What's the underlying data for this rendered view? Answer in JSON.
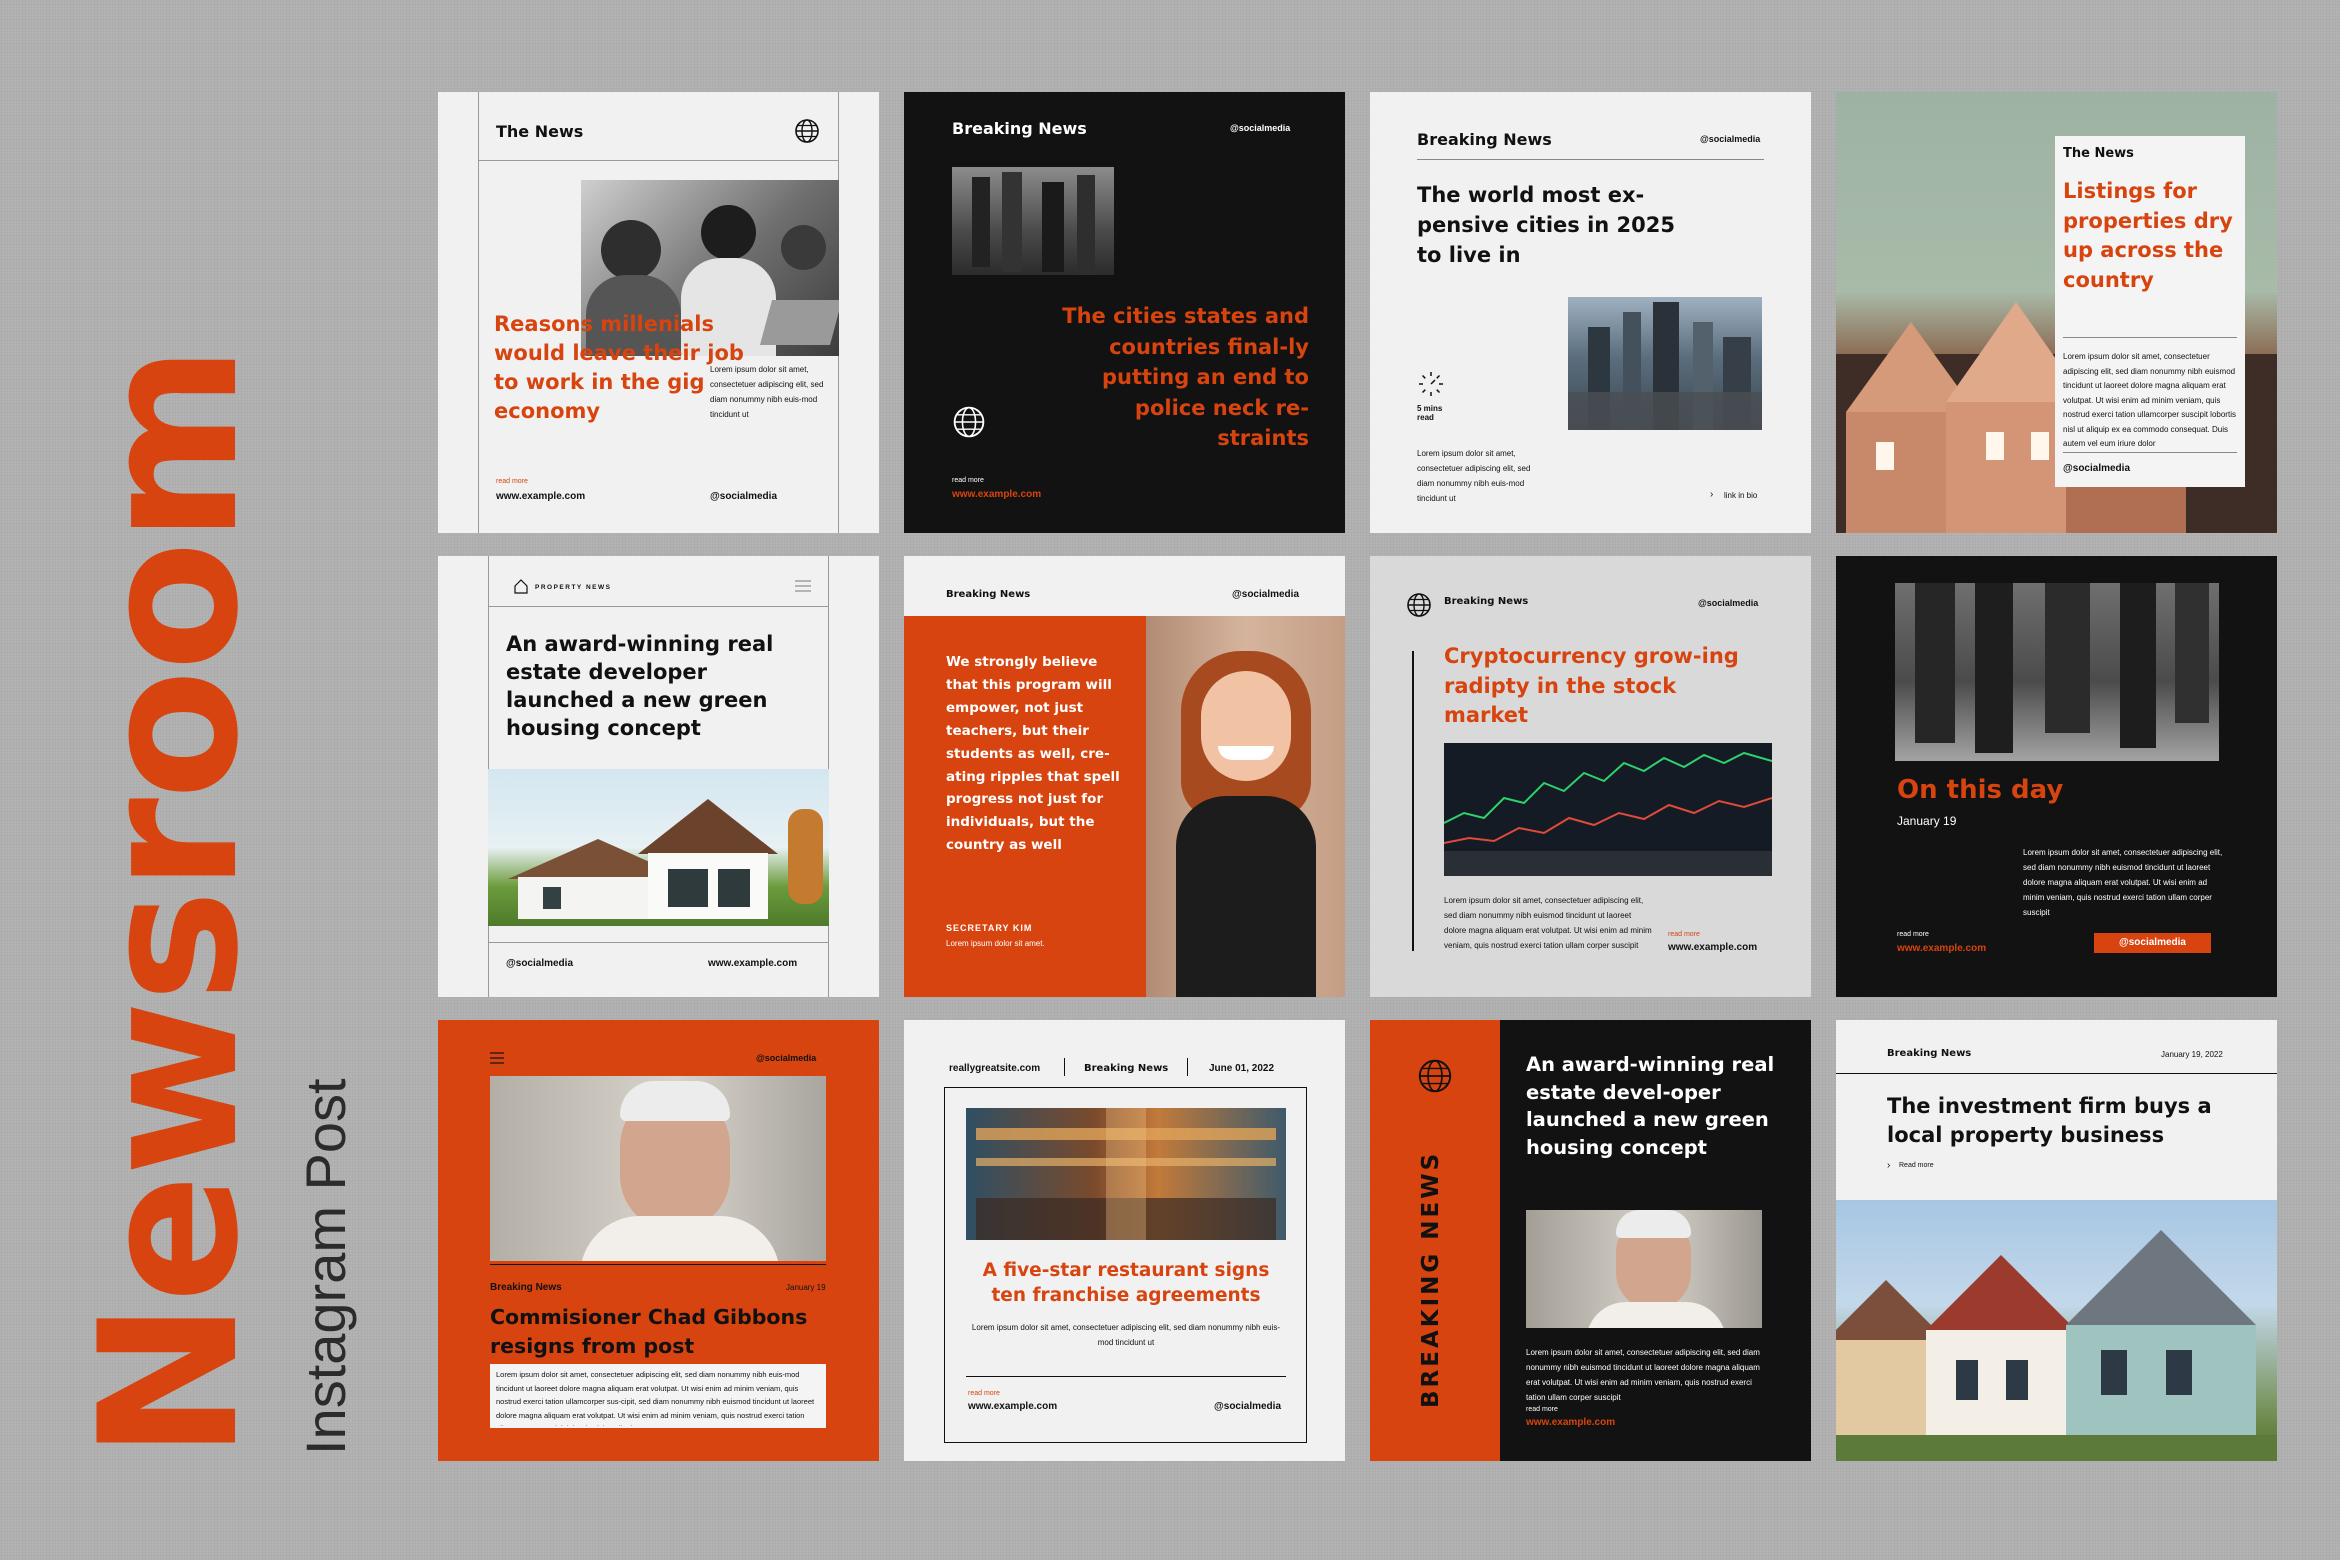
{
  "page": {
    "title": "Newsroom",
    "subtitle": "Instagram Post"
  },
  "colors": {
    "accent": "#d7440f",
    "dark": "#111111",
    "light": "#f1f1f1",
    "background": "#b3b3b3"
  },
  "cards": {
    "c1": {
      "brand": "The News",
      "headline": "Reasons millenials would leave their job to work in the gig economy",
      "body": "Lorem ipsum dolor sit amet, consectetuer adipiscing elit, sed diam nonummy nibh euis-mod tincidunt ut",
      "read_more": "read more",
      "website": "www.example.com",
      "handle": "@socialmedia",
      "icon": "globe-icon"
    },
    "c2": {
      "brand": "Breaking News",
      "handle": "@socialmedia",
      "headline": "The cities states and countries final-ly putting an end to police neck re-straints",
      "read_more": "read more",
      "website": "www.example.com",
      "icon": "globe-icon"
    },
    "c3": {
      "brand": "Breaking News",
      "handle": "@socialmedia",
      "headline": "The world most ex-pensive cities in 2025 to live in",
      "read_time": "5 mins read",
      "body": "Lorem ipsum dolor sit amet, consectetuer adipiscing elit, sed diam nonummy nibh euis-mod tincidunt ut",
      "link": "link in bio",
      "icon": "clock-icon"
    },
    "c4": {
      "brand": "The News",
      "headline": "Listings for properties dry up across the country",
      "body": "Lorem ipsum dolor sit amet, consectetuer adipiscing elit, sed diam nonummy nibh euismod tincidunt ut laoreet dolore magna aliquam erat volutpat. Ut wisi enim ad minim veniam, quis nostrud exerci tation ullamcorper suscipit lobortis nisl ut aliquip ex ea commodo consequat. Duis autem vel eum iriure dolor",
      "handle": "@socialmedia"
    },
    "c5": {
      "brand": "PROPERTY NEWS",
      "headline": "An award-winning real estate developer launched a new green housing concept",
      "handle": "@socialmedia",
      "website": "www.example.com",
      "icons": [
        "home-icon",
        "menu-icon"
      ]
    },
    "c6": {
      "brand": "Breaking News",
      "handle": "@socialmedia",
      "quote": "We strongly believe that this program will empower, not just teachers, but their students as well, cre-ating ripples that spell progress not just for individuals, but the country as well",
      "speaker": "SECRETARY KIM",
      "body": "Lorem ipsum dolor sit amet."
    },
    "c7": {
      "brand": "Breaking News",
      "handle": "@socialmedia",
      "headline": "Cryptocurrency grow-ing radipty in the stock market",
      "body": "Lorem ipsum dolor sit amet, consectetuer adipiscing elit, sed diam nonummy nibh euismod tincidunt ut laoreet dolore magna aliquam erat volutpat. Ut wisi enim ad minim veniam, quis nostrud exerci tation ullam corper suscipit",
      "read_more": "read more",
      "website": "www.example.com",
      "icon": "globe-icon"
    },
    "c8": {
      "headline": "On this day",
      "date": "January 19",
      "body": "Lorem ipsum dolor sit amet, consectetuer adipiscing elit, sed diam nonummy nibh euismod tincidunt ut laoreet dolore magna aliquam erat volutpat. Ut wisi enim ad minim veniam, quis nostrud exerci tation ullam corper suscipit",
      "read_more": "read more",
      "website": "www.example.com",
      "handle": "@socialmedia"
    },
    "c9": {
      "handle": "@socialmedia",
      "brand": "Breaking News",
      "date": "January 19",
      "headline": "Commisioner Chad Gibbons resigns from post",
      "body": "Lorem ipsum dolor sit amet, consectetuer adipiscing elit, sed diam nonummy nibh euis-mod tincidunt ut laoreet dolore magna aliquam erat volutpat. Ut wisi enim ad minim veniam, quis nostrud exerci tation ullamcorper sus-cipit, sed diam nonummy nibh euismod tincidunt ut laoreet dolore magna aliquam erat volutpat. Ut wisi enim ad minim veniam, quis nostrud exerci tation ullamcorper sus-cipit lobortis nisl ut aliquip",
      "icon": "menu-icon"
    },
    "c10": {
      "site": "reallygreatsite.com",
      "brand": "Breaking News",
      "date": "June 01, 2022",
      "headline": "A five-star restaurant signs ten franchise agreements",
      "body": "Lorem ipsum dolor sit amet, consectetuer adipiscing elit, sed diam nonummy nibh euis-mod tincidunt ut",
      "read_more": "read more",
      "website": "www.example.com",
      "handle": "@socialmedia"
    },
    "c11": {
      "side_label": "BREAKING NEWS",
      "headline": "An award-winning real estate devel-oper launched a new green housing concept",
      "body": "Lorem ipsum dolor sit amet, consectetuer adipiscing elit, sed diam nonummy nibh euismod tincidunt ut laoreet dolore magna aliquam erat volutpat. Ut wisi enim ad minim veniam, quis nostrud exerci tation ullam corper suscipit",
      "read_more": "read more",
      "website": "www.example.com",
      "icon": "globe-icon"
    },
    "c12": {
      "brand": "Breaking News",
      "date": "January 19, 2022",
      "headline": "The investment firm buys a local property business",
      "read_more": "Read more"
    }
  }
}
